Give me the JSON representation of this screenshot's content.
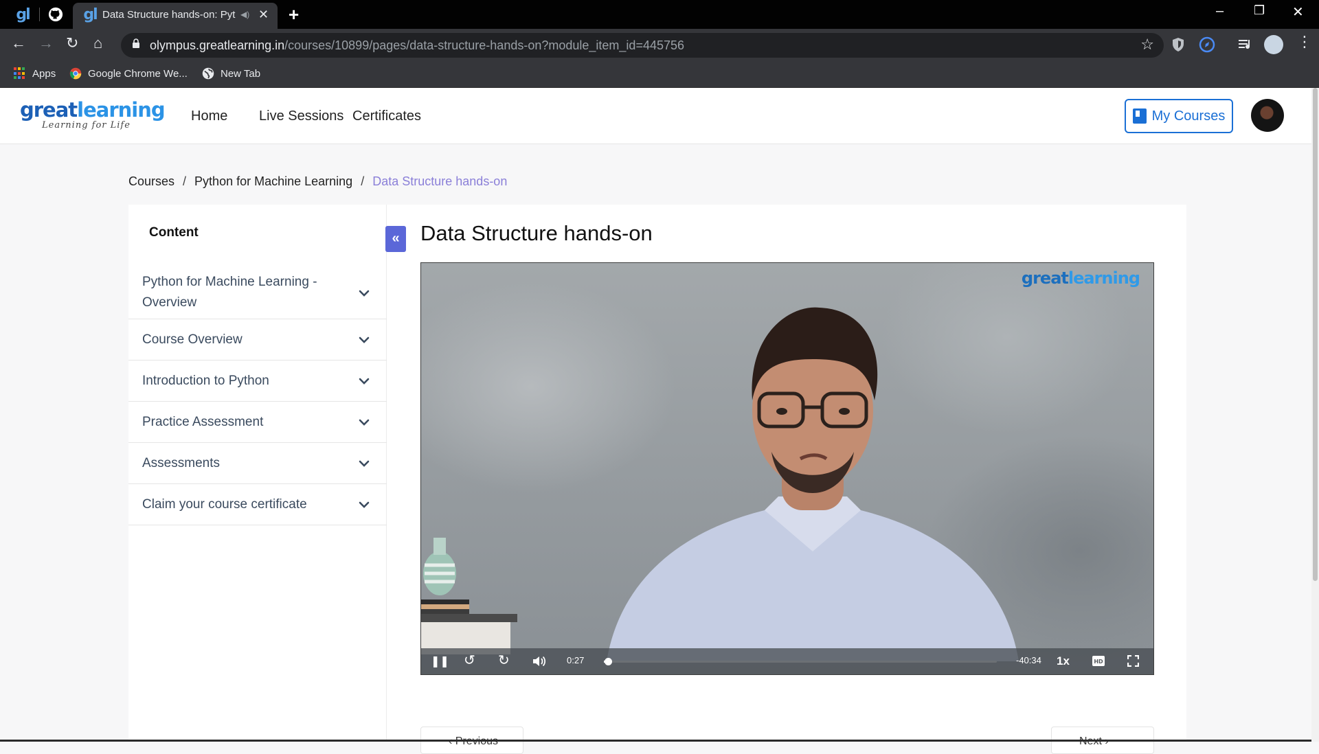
{
  "browser": {
    "tabs": [
      {
        "title": "Data Structure hands-on: Pyt",
        "active": true
      }
    ],
    "window_controls": {
      "minimize": "–",
      "restore": "❐",
      "close": "✕"
    },
    "url": {
      "host": "olympus.greatlearning.in",
      "path": "/courses/10899/pages/data-structure-hands-on?module_item_id=445756"
    },
    "bookmarks": [
      {
        "label": "Apps"
      },
      {
        "label": "Google Chrome We..."
      },
      {
        "label": "New Tab"
      }
    ]
  },
  "site": {
    "brand_part1": "great",
    "brand_part2": "learning",
    "tagline": "Learning for Life",
    "nav": [
      "Home",
      "Live Sessions",
      "Certificates"
    ],
    "my_courses_label": "My Courses"
  },
  "breadcrumb": [
    "Courses",
    "Python for Machine Learning",
    "Data Structure hands-on"
  ],
  "sidebar": {
    "title": "Content",
    "items": [
      "Python for Machine Learning - Overview",
      "Course Overview",
      "Introduction to Python",
      "Practice Assessment",
      "Assessments",
      "Claim your course certificate"
    ]
  },
  "main": {
    "title": "Data Structure hands-on",
    "video": {
      "watermark_part1": "great",
      "watermark_part2": "learning",
      "elapsed": "0:27",
      "remaining": "-40:34",
      "speed": "1x",
      "progress_fraction": 0.011
    },
    "prev_label": "Previous",
    "next_label": "Next"
  },
  "colors": {
    "accent": "#1a6fd5",
    "breadcrumb_current": "#8a7fd8",
    "collapse_button": "#5b67d8"
  }
}
